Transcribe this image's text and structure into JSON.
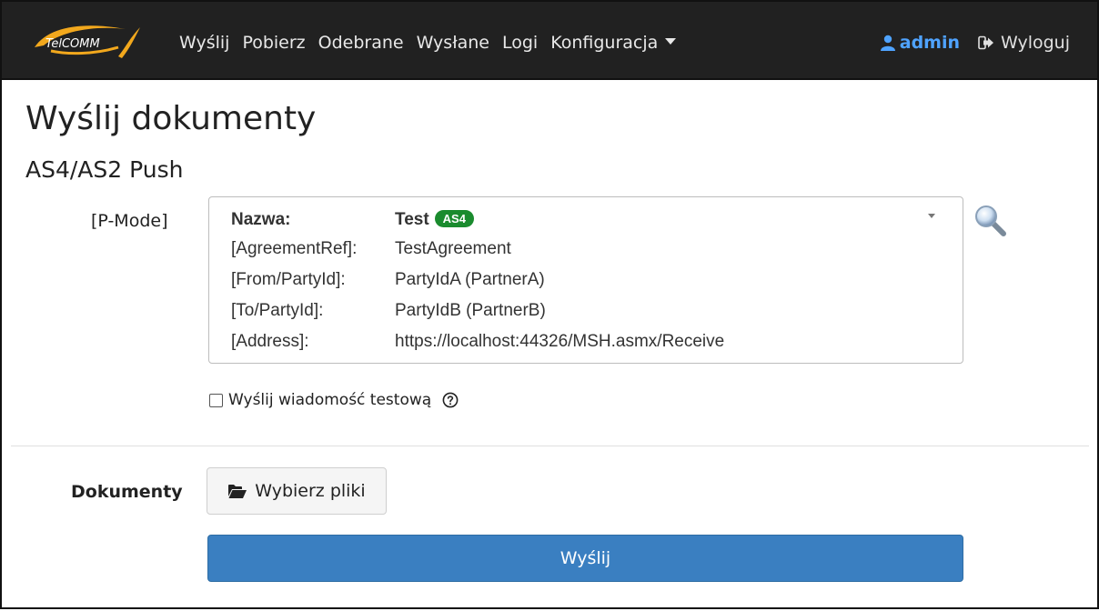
{
  "brand": {
    "logo_text": "TelCOMM"
  },
  "nav": {
    "links": [
      "Wyślij",
      "Pobierz",
      "Odebrane",
      "Wysłane",
      "Logi"
    ],
    "dropdown_label": "Konfiguracja",
    "user": "admin",
    "logout": "Wyloguj"
  },
  "page": {
    "title": "Wyślij dokumenty",
    "subtitle": "AS4/AS2 Push"
  },
  "pmode": {
    "label": "[P-Mode]",
    "name_key": "Nazwa:",
    "name_value": "Test",
    "badge": "AS4",
    "rows": [
      {
        "key": "[AgreementRef]:",
        "value": "TestAgreement"
      },
      {
        "key": "[From/PartyId]:",
        "value": "PartyIdA (PartnerA)"
      },
      {
        "key": "[To/PartyId]:",
        "value": "PartyIdB (PartnerB)"
      },
      {
        "key": "[Address]:",
        "value": "https://localhost:44326/MSH.asmx/Receive"
      }
    ]
  },
  "test_message": {
    "label": "Wyślij wiadomość testową",
    "checked": false
  },
  "documents": {
    "label": "Dokumenty",
    "choose_button": "Wybierz pliki"
  },
  "submit": {
    "label": "Wyślij"
  },
  "colors": {
    "navbar_bg": "#212121",
    "user_link": "#4fa3ff",
    "badge_green": "#1a8b2e",
    "primary_button": "#3a7fc1"
  }
}
